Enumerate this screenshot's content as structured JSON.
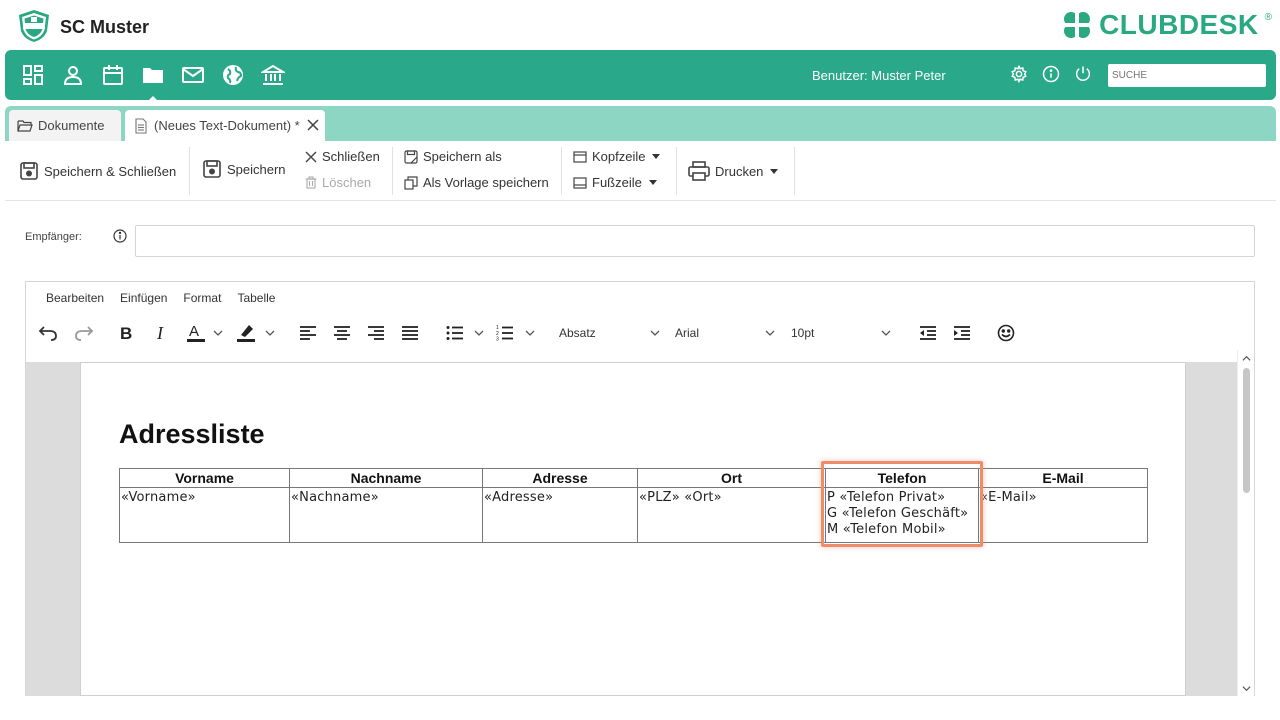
{
  "header": {
    "club_name": "SC Muster",
    "logo_text": "SC MUSTER",
    "brand": "CLUBDESK",
    "brand_mark": "®"
  },
  "nav": {
    "icons": [
      "dashboard-icon",
      "person-icon",
      "calendar-icon",
      "folder-icon",
      "mail-icon",
      "globe-icon",
      "bank-icon"
    ],
    "active": "folder-icon",
    "user_label": "Benutzer: Muster Peter",
    "search_placeholder": "SUCHE"
  },
  "tabs": [
    {
      "label": "Dokumente",
      "icon": "folder-open-icon"
    },
    {
      "label": "(Neues Text-Dokument) *",
      "icon": "document-icon"
    }
  ],
  "toolbar": {
    "save_close": "Speichern & Schließen",
    "save": "Speichern",
    "close": "Schließen",
    "delete": "Löschen",
    "save_as": "Speichern als",
    "save_template": "Als Vorlage speichern",
    "header": "Kopfzeile",
    "footer": "Fußzeile",
    "print": "Drucken"
  },
  "recipient": {
    "label": "Empfänger:",
    "value": ""
  },
  "editor": {
    "menu": [
      "Bearbeiten",
      "Einfügen",
      "Format",
      "Tabelle"
    ],
    "block_format": "Absatz",
    "font": "Arial",
    "size": "10pt"
  },
  "document": {
    "title": "Adressliste",
    "columns": [
      "Vorname",
      "Nachname",
      "Adresse",
      "Ort",
      "Telefon",
      "E-Mail"
    ],
    "row": [
      "«Vorname»",
      "«Nachname»",
      "«Adresse»",
      "«PLZ» «Ort»",
      [
        "P «Telefon Privat»",
        "G «Telefon Geschäft»",
        "M «Telefon Mobil»"
      ],
      "«E-Mail»"
    ]
  },
  "colors": {
    "primary_green": "#2aa88a",
    "tab_green": "#8dd6c4",
    "highlight": "#ef8c6b"
  }
}
